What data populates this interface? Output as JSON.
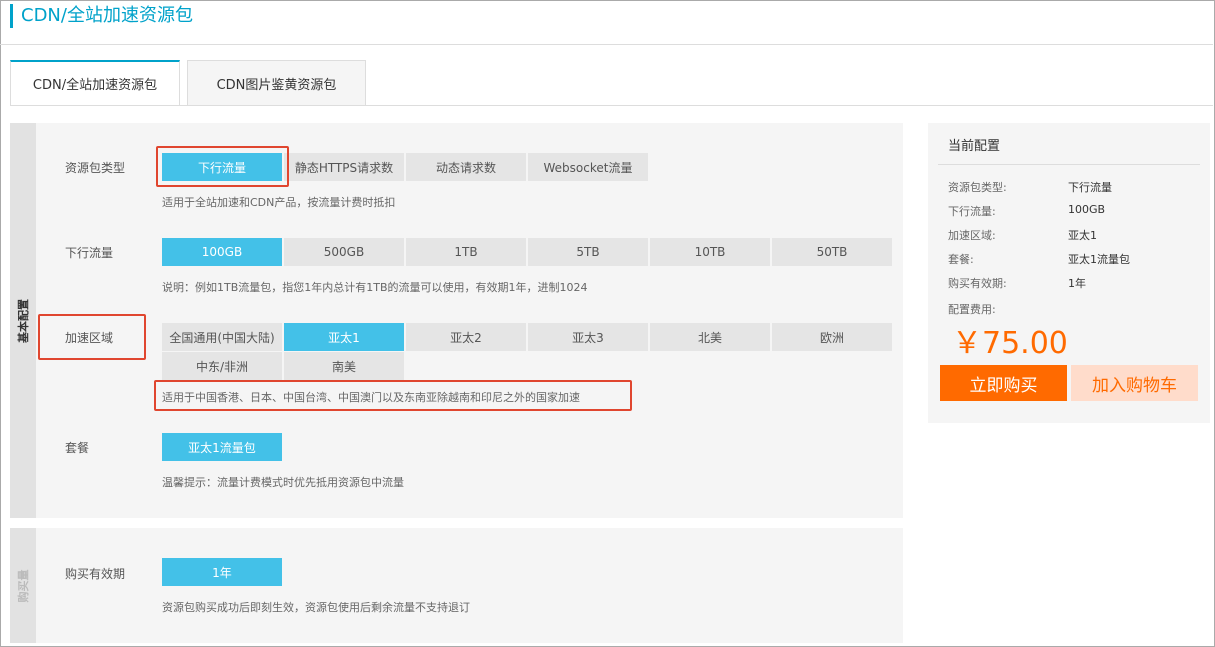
{
  "page": {
    "title": "CDN/全站加速资源包"
  },
  "tabs": [
    {
      "label": "CDN/全站加速资源包"
    },
    {
      "label": "CDN图片鉴黄资源包"
    }
  ],
  "basic": {
    "side_label": "基本配置",
    "package_type": {
      "label": "资源包类型",
      "options": [
        "下行流量",
        "静态HTTPS请求数",
        "动态请求数",
        "Websocket流量"
      ],
      "selected": "下行流量",
      "hint": "适用于全站加速和CDN产品，按流量计费时抵扣"
    },
    "traffic": {
      "label": "下行流量",
      "options": [
        "100GB",
        "500GB",
        "1TB",
        "5TB",
        "10TB",
        "50TB"
      ],
      "selected": "100GB",
      "hint": "说明：例如1TB流量包，指您1年内总计有1TB的流量可以使用，有效期1年，进制1024"
    },
    "region": {
      "label": "加速区域",
      "options": [
        "全国通用(中国大陆)",
        "亚太1",
        "亚太2",
        "亚太3",
        "北美",
        "欧洲",
        "中东/非洲",
        "南美"
      ],
      "selected": "亚太1",
      "hint": "适用于中国香港、日本、中国台湾、中国澳门以及东南亚除越南和印尼之外的国家加速"
    },
    "plan": {
      "label": "套餐",
      "options": [
        "亚太1流量包"
      ],
      "selected": "亚太1流量包",
      "hint": "温馨提示：流量计费模式时优先抵用资源包中流量"
    }
  },
  "purchase": {
    "side_label": "购买量",
    "validity": {
      "label": "购买有效期",
      "options": [
        "1年"
      ],
      "selected": "1年",
      "hint": "资源包购买成功后即刻生效，资源包使用后剩余流量不支持退订"
    }
  },
  "summary": {
    "title": "当前配置",
    "rows": [
      {
        "key": "资源包类型:",
        "value": "下行流量"
      },
      {
        "key": "下行流量:",
        "value": "100GB"
      },
      {
        "key": "加速区域:",
        "value": "亚太1"
      },
      {
        "key": "套餐:",
        "value": "亚太1流量包"
      },
      {
        "key": "购买有效期:",
        "value": "1年"
      }
    ],
    "fee_label": "配置费用:",
    "price": "￥75.00",
    "buy_label": "立即购买",
    "cart_label": "加入购物车"
  },
  "colors": {
    "accent": "#00a2ca",
    "selected": "#43c1e8",
    "orange": "#ff6a00",
    "highlight": "#e0462f"
  }
}
